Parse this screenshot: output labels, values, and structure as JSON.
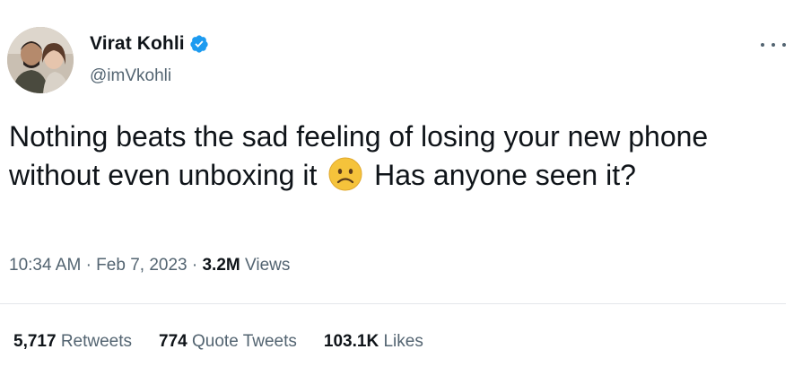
{
  "author": {
    "display_name": "Virat Kohli",
    "handle": "@imVkohli",
    "verified": true,
    "avatar_icon": "profile-photo"
  },
  "tweet": {
    "text_before_emoji": "Nothing beats the sad feeling of losing your new phone without even unboxing it",
    "emoji": "sad-face-emoji",
    "text_after_emoji": "Has anyone seen it?"
  },
  "meta": {
    "time": "10:34 AM",
    "separator": "·",
    "date": "Feb 7, 2023",
    "views_count": "3.2M",
    "views_label": "Views"
  },
  "stats": {
    "retweets_count": "5,717",
    "retweets_label": "Retweets",
    "quotes_count": "774",
    "quotes_label": "Quote Tweets",
    "likes_count": "103.1K",
    "likes_label": "Likes"
  },
  "colors": {
    "text_primary": "#0f1419",
    "text_secondary": "#536471",
    "verified_blue": "#1d9bf0",
    "divider": "#e4e7ea"
  },
  "icons": [
    "more-options-icon",
    "verified-badge-icon"
  ]
}
